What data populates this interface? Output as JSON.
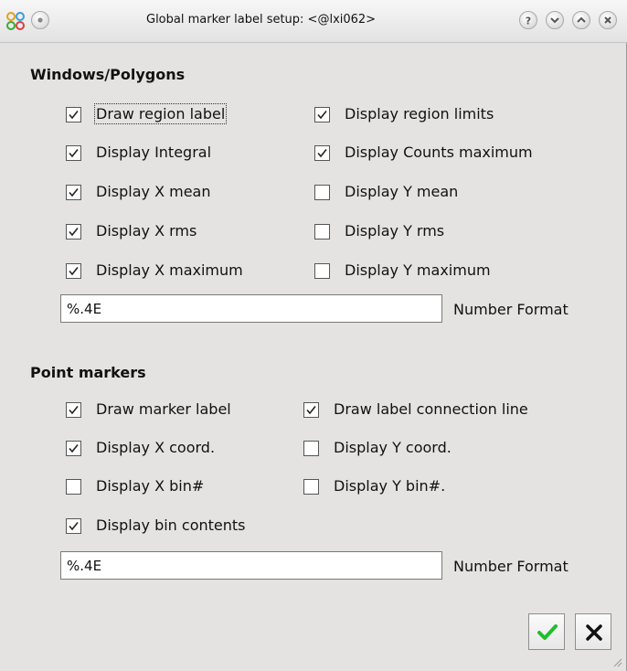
{
  "window": {
    "title": "Global marker label setup: <@lxi062>"
  },
  "windows_polygons": {
    "heading": "Windows/Polygons",
    "checkboxes": [
      {
        "label": "Draw region label",
        "checked": true
      },
      {
        "label": "Display region limits",
        "checked": true
      },
      {
        "label": "Display Integral",
        "checked": true
      },
      {
        "label": "Display Counts maximum",
        "checked": true
      },
      {
        "label": "Display X mean",
        "checked": true
      },
      {
        "label": "Display Y mean",
        "checked": false
      },
      {
        "label": "Display X rms",
        "checked": true
      },
      {
        "label": "Display Y rms",
        "checked": false
      },
      {
        "label": "Display X maximum",
        "checked": true
      },
      {
        "label": "Display Y maximum",
        "checked": false
      }
    ],
    "number_format_value": "%.4E",
    "number_format_label": "Number Format"
  },
  "point_markers": {
    "heading": "Point markers",
    "checkboxes": [
      {
        "label": "Draw marker label",
        "checked": true
      },
      {
        "label": "Draw label connection line",
        "checked": true
      },
      {
        "label": "Display X coord.",
        "checked": true
      },
      {
        "label": "Display Y coord.",
        "checked": false
      },
      {
        "label": "Display X bin#",
        "checked": false
      },
      {
        "label": "Display Y bin#.",
        "checked": false
      },
      {
        "label": "Display bin contents",
        "checked": true
      }
    ],
    "number_format_value": "%.4E",
    "number_format_label": "Number Format"
  },
  "colors": {
    "ok_check": "#1fbf2a",
    "cancel_x": "#111111",
    "background": "#e4e3e1"
  },
  "icons": {
    "app": "app-icon",
    "title_buttons": [
      "menu-icon",
      "help-icon",
      "minimize-icon",
      "maximize-icon",
      "close-icon"
    ],
    "ok": "checkmark-icon",
    "cancel": "cancel-icon"
  }
}
